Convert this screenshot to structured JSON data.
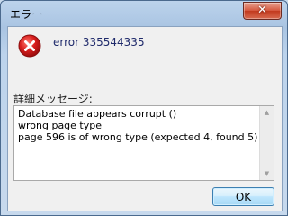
{
  "window": {
    "title": "エラー",
    "close_glyph": "✕"
  },
  "dialog": {
    "icon": "error-icon",
    "message": "error 335544335",
    "details_label": "詳細メッセージ:",
    "details_text": "Database file appears corrupt ()\nwrong page type\npage 596 is of wrong type (expected 4, found 5)",
    "ok_label": "OK"
  },
  "scrollbar": {
    "up_glyph": "▲",
    "down_glyph": "▼"
  },
  "colors": {
    "error_red": "#d81e1e",
    "message_text": "#1f2a6b",
    "ok_border": "#3c7fb1"
  }
}
